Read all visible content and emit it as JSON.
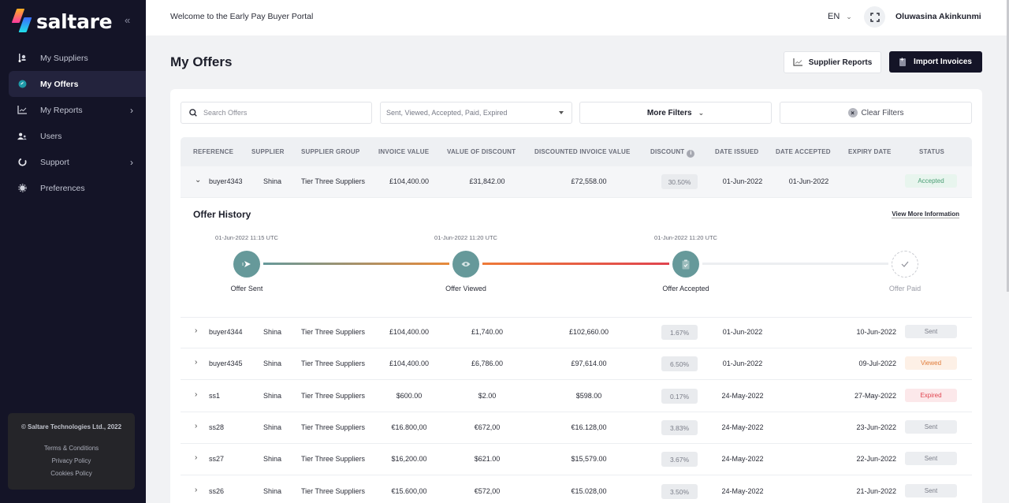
{
  "app": {
    "brand": "saltare",
    "welcome": "Welcome to the Early Pay Buyer Portal",
    "language": "EN",
    "user_name": "Oluwasina Akinkunmi"
  },
  "sidebar": {
    "collapse_icon": "«",
    "items": [
      {
        "label": "My Suppliers",
        "icon": "suppliers-icon",
        "active": false,
        "has_children": false
      },
      {
        "label": "My Offers",
        "icon": "offers-badge-icon",
        "active": true,
        "has_children": false
      },
      {
        "label": "My Reports",
        "icon": "chart-icon",
        "active": false,
        "has_children": true
      },
      {
        "label": "Users",
        "icon": "users-icon",
        "active": false,
        "has_children": false
      },
      {
        "label": "Support",
        "icon": "support-icon",
        "active": false,
        "has_children": true
      },
      {
        "label": "Preferences",
        "icon": "gear-icon",
        "active": false,
        "has_children": false
      }
    ],
    "footer": {
      "copyright": "© Saltare Technologies Ltd., 2022",
      "links": [
        "Terms & Conditions",
        "Privacy Policy",
        "Cookies Policy"
      ]
    }
  },
  "page": {
    "title": "My Offers",
    "supplier_reports_label": "Supplier Reports",
    "import_invoices_label": "Import Invoices"
  },
  "filters": {
    "search_placeholder": "Search Offers",
    "search_value": "",
    "status_value": "Sent, Viewed, Accepted, Paid, Expired",
    "more_filters_label": "More Filters",
    "clear_filters_label": "Clear Filters"
  },
  "table": {
    "columns": [
      "REFERENCE",
      "SUPPLIER",
      "SUPPLIER GROUP",
      "INVOICE VALUE",
      "VALUE OF DISCOUNT",
      "DISCOUNTED INVOICE VALUE",
      "DISCOUNT",
      "DATE ISSUED",
      "DATE ACCEPTED",
      "EXPIRY DATE",
      "STATUS"
    ],
    "rows": [
      {
        "reference": "buyer4343",
        "supplier": "Shina",
        "group": "Tier Three Suppliers",
        "invoice_value": "£104,400.00",
        "discount_value": "£31,842.00",
        "discounted_value": "£72,558.00",
        "discount": "30.50%",
        "date_issued": "01-Jun-2022",
        "date_accepted": "01-Jun-2022",
        "expiry_date": "",
        "status": "Accepted",
        "expanded": true
      },
      {
        "reference": "buyer4344",
        "supplier": "Shina",
        "group": "Tier Three Suppliers",
        "invoice_value": "£104,400.00",
        "discount_value": "£1,740.00",
        "discounted_value": "£102,660.00",
        "discount": "1.67%",
        "date_issued": "01-Jun-2022",
        "date_accepted": "",
        "expiry_date": "10-Jun-2022",
        "status": "Sent",
        "expanded": false
      },
      {
        "reference": "buyer4345",
        "supplier": "Shina",
        "group": "Tier Three Suppliers",
        "invoice_value": "£104,400.00",
        "discount_value": "£6,786.00",
        "discounted_value": "£97,614.00",
        "discount": "6.50%",
        "date_issued": "01-Jun-2022",
        "date_accepted": "",
        "expiry_date": "09-Jul-2022",
        "status": "Viewed",
        "expanded": false
      },
      {
        "reference": "ss1",
        "supplier": "Shina",
        "group": "Tier Three Suppliers",
        "invoice_value": "$600.00",
        "discount_value": "$2.00",
        "discounted_value": "$598.00",
        "discount": "0.17%",
        "date_issued": "24-May-2022",
        "date_accepted": "",
        "expiry_date": "27-May-2022",
        "status": "Expired",
        "expanded": false
      },
      {
        "reference": "ss28",
        "supplier": "Shina",
        "group": "Tier Three Suppliers",
        "invoice_value": "€16.800,00",
        "discount_value": "€672,00",
        "discounted_value": "€16.128,00",
        "discount": "3.83%",
        "date_issued": "24-May-2022",
        "date_accepted": "",
        "expiry_date": "23-Jun-2022",
        "status": "Sent",
        "expanded": false
      },
      {
        "reference": "ss27",
        "supplier": "Shina",
        "group": "Tier Three Suppliers",
        "invoice_value": "$16,200.00",
        "discount_value": "$621.00",
        "discounted_value": "$15,579.00",
        "discount": "3.67%",
        "date_issued": "24-May-2022",
        "date_accepted": "",
        "expiry_date": "22-Jun-2022",
        "status": "Sent",
        "expanded": false
      },
      {
        "reference": "ss26",
        "supplier": "Shina",
        "group": "Tier Three Suppliers",
        "invoice_value": "€15.600,00",
        "discount_value": "€572,00",
        "discounted_value": "€15.028,00",
        "discount": "3.50%",
        "date_issued": "24-May-2022",
        "date_accepted": "",
        "expiry_date": "21-Jun-2022",
        "status": "Sent",
        "expanded": false
      }
    ]
  },
  "status_colors": {
    "Accepted": {
      "bg": "#e8f5ee",
      "fg": "#4a9d74"
    },
    "Sent": {
      "bg": "#eceef1",
      "fg": "#7a7d88"
    },
    "Viewed": {
      "bg": "#fdf0e6",
      "fg": "#e07b39"
    },
    "Expired": {
      "bg": "#fce8ea",
      "fg": "#e0444f"
    }
  },
  "offer_history": {
    "title": "Offer History",
    "view_more_label": "View More Information",
    "steps": [
      {
        "label": "Offer Sent",
        "timestamp": "01-Jun-2022 11:15 UTC",
        "done": true,
        "icon": "send-icon"
      },
      {
        "label": "Offer Viewed",
        "timestamp": "01-Jun-2022 11:20 UTC",
        "done": true,
        "icon": "eye-icon"
      },
      {
        "label": "Offer Accepted",
        "timestamp": "01-Jun-2022 11:20 UTC",
        "done": true,
        "icon": "clipboard-check-icon"
      },
      {
        "label": "Offer Paid",
        "timestamp": "",
        "done": false,
        "icon": "check-icon"
      }
    ],
    "colors": {
      "step": "#66999a",
      "seg1_start": "#66999a",
      "seg1_end": "#e88a3a",
      "seg2_start": "#ee7a38",
      "seg2_end": "#e0444f",
      "pending": "#eceef1"
    }
  }
}
